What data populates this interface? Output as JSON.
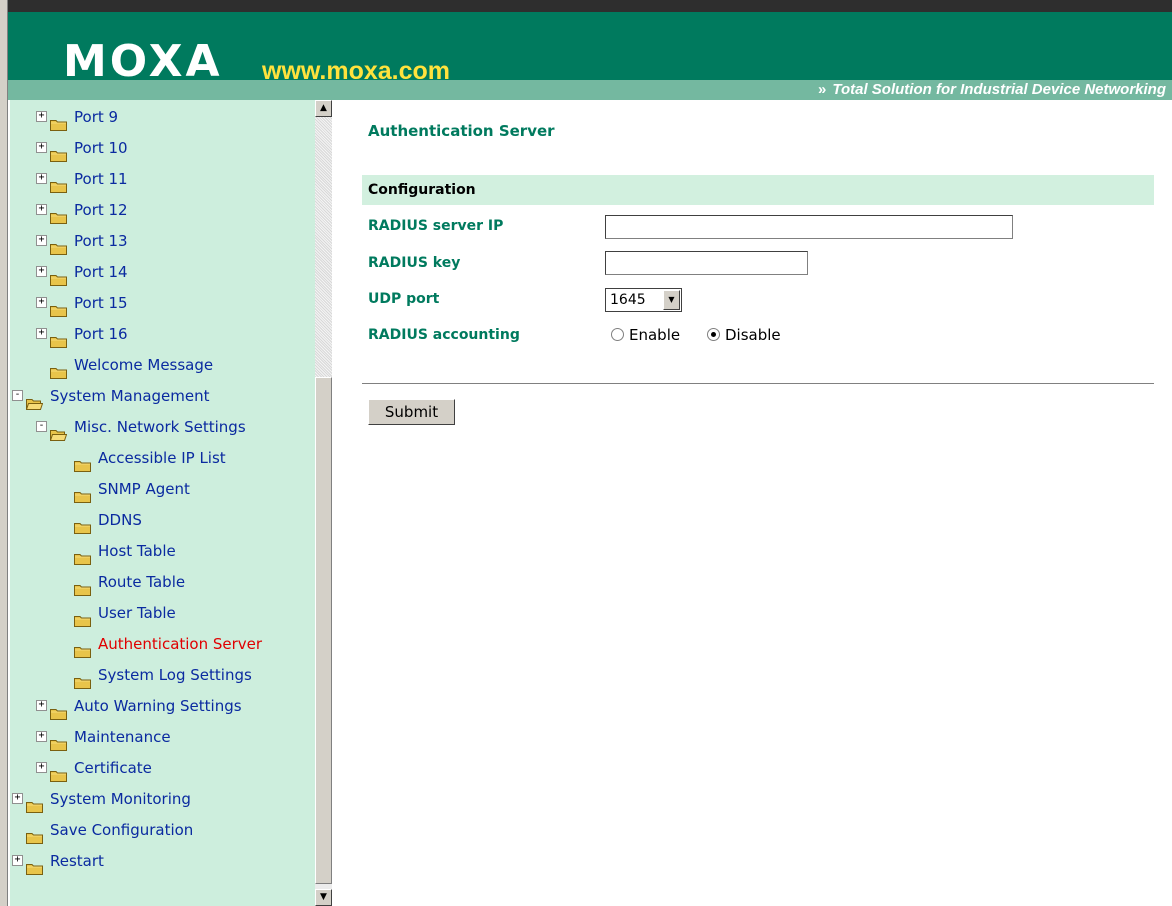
{
  "header": {
    "logo_text": "MOXA",
    "logo_url": "www.moxa.com",
    "tagline_glyph": "»",
    "tagline": "Total Solution for Industrial Device Networking"
  },
  "sidebar": {
    "items": [
      {
        "label": "Port 9",
        "expander": "+",
        "folder": "closed"
      },
      {
        "label": "Port 10",
        "expander": "+",
        "folder": "closed"
      },
      {
        "label": "Port 11",
        "expander": "+",
        "folder": "closed"
      },
      {
        "label": "Port 12",
        "expander": "+",
        "folder": "closed"
      },
      {
        "label": "Port 13",
        "expander": "+",
        "folder": "closed"
      },
      {
        "label": "Port 14",
        "expander": "+",
        "folder": "closed"
      },
      {
        "label": "Port 15",
        "expander": "+",
        "folder": "closed"
      },
      {
        "label": "Port 16",
        "expander": "+",
        "folder": "closed"
      },
      {
        "label": "Welcome Message",
        "expander": "",
        "folder": "closed"
      },
      {
        "label": "System Management",
        "expander": "-",
        "folder": "open"
      },
      {
        "label": "Misc. Network Settings",
        "expander": "-",
        "folder": "open"
      },
      {
        "label": "Accessible IP List",
        "expander": "",
        "folder": "closed"
      },
      {
        "label": "SNMP Agent",
        "expander": "",
        "folder": "closed"
      },
      {
        "label": "DDNS",
        "expander": "",
        "folder": "closed"
      },
      {
        "label": "Host Table",
        "expander": "",
        "folder": "closed"
      },
      {
        "label": "Route Table",
        "expander": "",
        "folder": "closed"
      },
      {
        "label": "User Table",
        "expander": "",
        "folder": "closed"
      },
      {
        "label": "Authentication Server",
        "expander": "",
        "folder": "closed",
        "active": true
      },
      {
        "label": "System Log Settings",
        "expander": "",
        "folder": "closed"
      },
      {
        "label": "Auto Warning Settings",
        "expander": "+",
        "folder": "closed"
      },
      {
        "label": "Maintenance",
        "expander": "+",
        "folder": "closed"
      },
      {
        "label": "Certificate",
        "expander": "+",
        "folder": "closed"
      },
      {
        "label": "System Monitoring",
        "expander": "+",
        "folder": "closed"
      },
      {
        "label": "Save Configuration",
        "expander": "",
        "folder": "closed"
      },
      {
        "label": "Restart",
        "expander": "+",
        "folder": "closed"
      }
    ]
  },
  "scrollbar": {
    "up_glyph": "▲",
    "down_glyph": "▼"
  },
  "main": {
    "title": "Authentication Server",
    "section_header": "Configuration",
    "fields": {
      "radius_ip_label": "RADIUS server IP",
      "radius_ip_value": "",
      "radius_key_label": "RADIUS key",
      "radius_key_value": "",
      "udp_port_label": "UDP port",
      "udp_port_value": "1645",
      "udp_port_arrow": "▼",
      "accounting_label": "RADIUS accounting",
      "accounting_options": [
        "Enable",
        "Disable"
      ],
      "accounting_selected": "Disable"
    },
    "submit_label": "Submit"
  },
  "colors": {
    "brand_green": "#007a5e",
    "logo_url_yellow": "#ffe23d",
    "sidebar_bg": "#cdeedd",
    "link_blue": "#0a2aa0",
    "active_red": "#e00000",
    "folder_yellow": "#e8c44a"
  }
}
